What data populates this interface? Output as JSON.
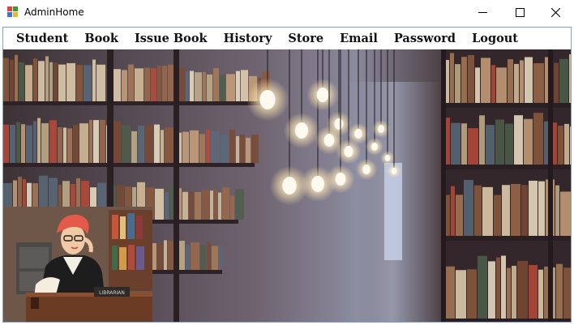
{
  "window": {
    "title": "AdminHome"
  },
  "menu": {
    "items": [
      {
        "id": "student",
        "label": "Student"
      },
      {
        "id": "book",
        "label": "Book"
      },
      {
        "id": "issue-book",
        "label": "Issue Book"
      },
      {
        "id": "history",
        "label": "History"
      },
      {
        "id": "store",
        "label": "Store"
      },
      {
        "id": "email",
        "label": "Email"
      },
      {
        "id": "password",
        "label": "Password"
      },
      {
        "id": "logout",
        "label": "Logout"
      }
    ]
  },
  "illustration": {
    "desk_sign": "LIBRARIAN"
  },
  "colors": {
    "frame_border": "#7ea3c8",
    "librarian_hair": "#e35a4a"
  }
}
